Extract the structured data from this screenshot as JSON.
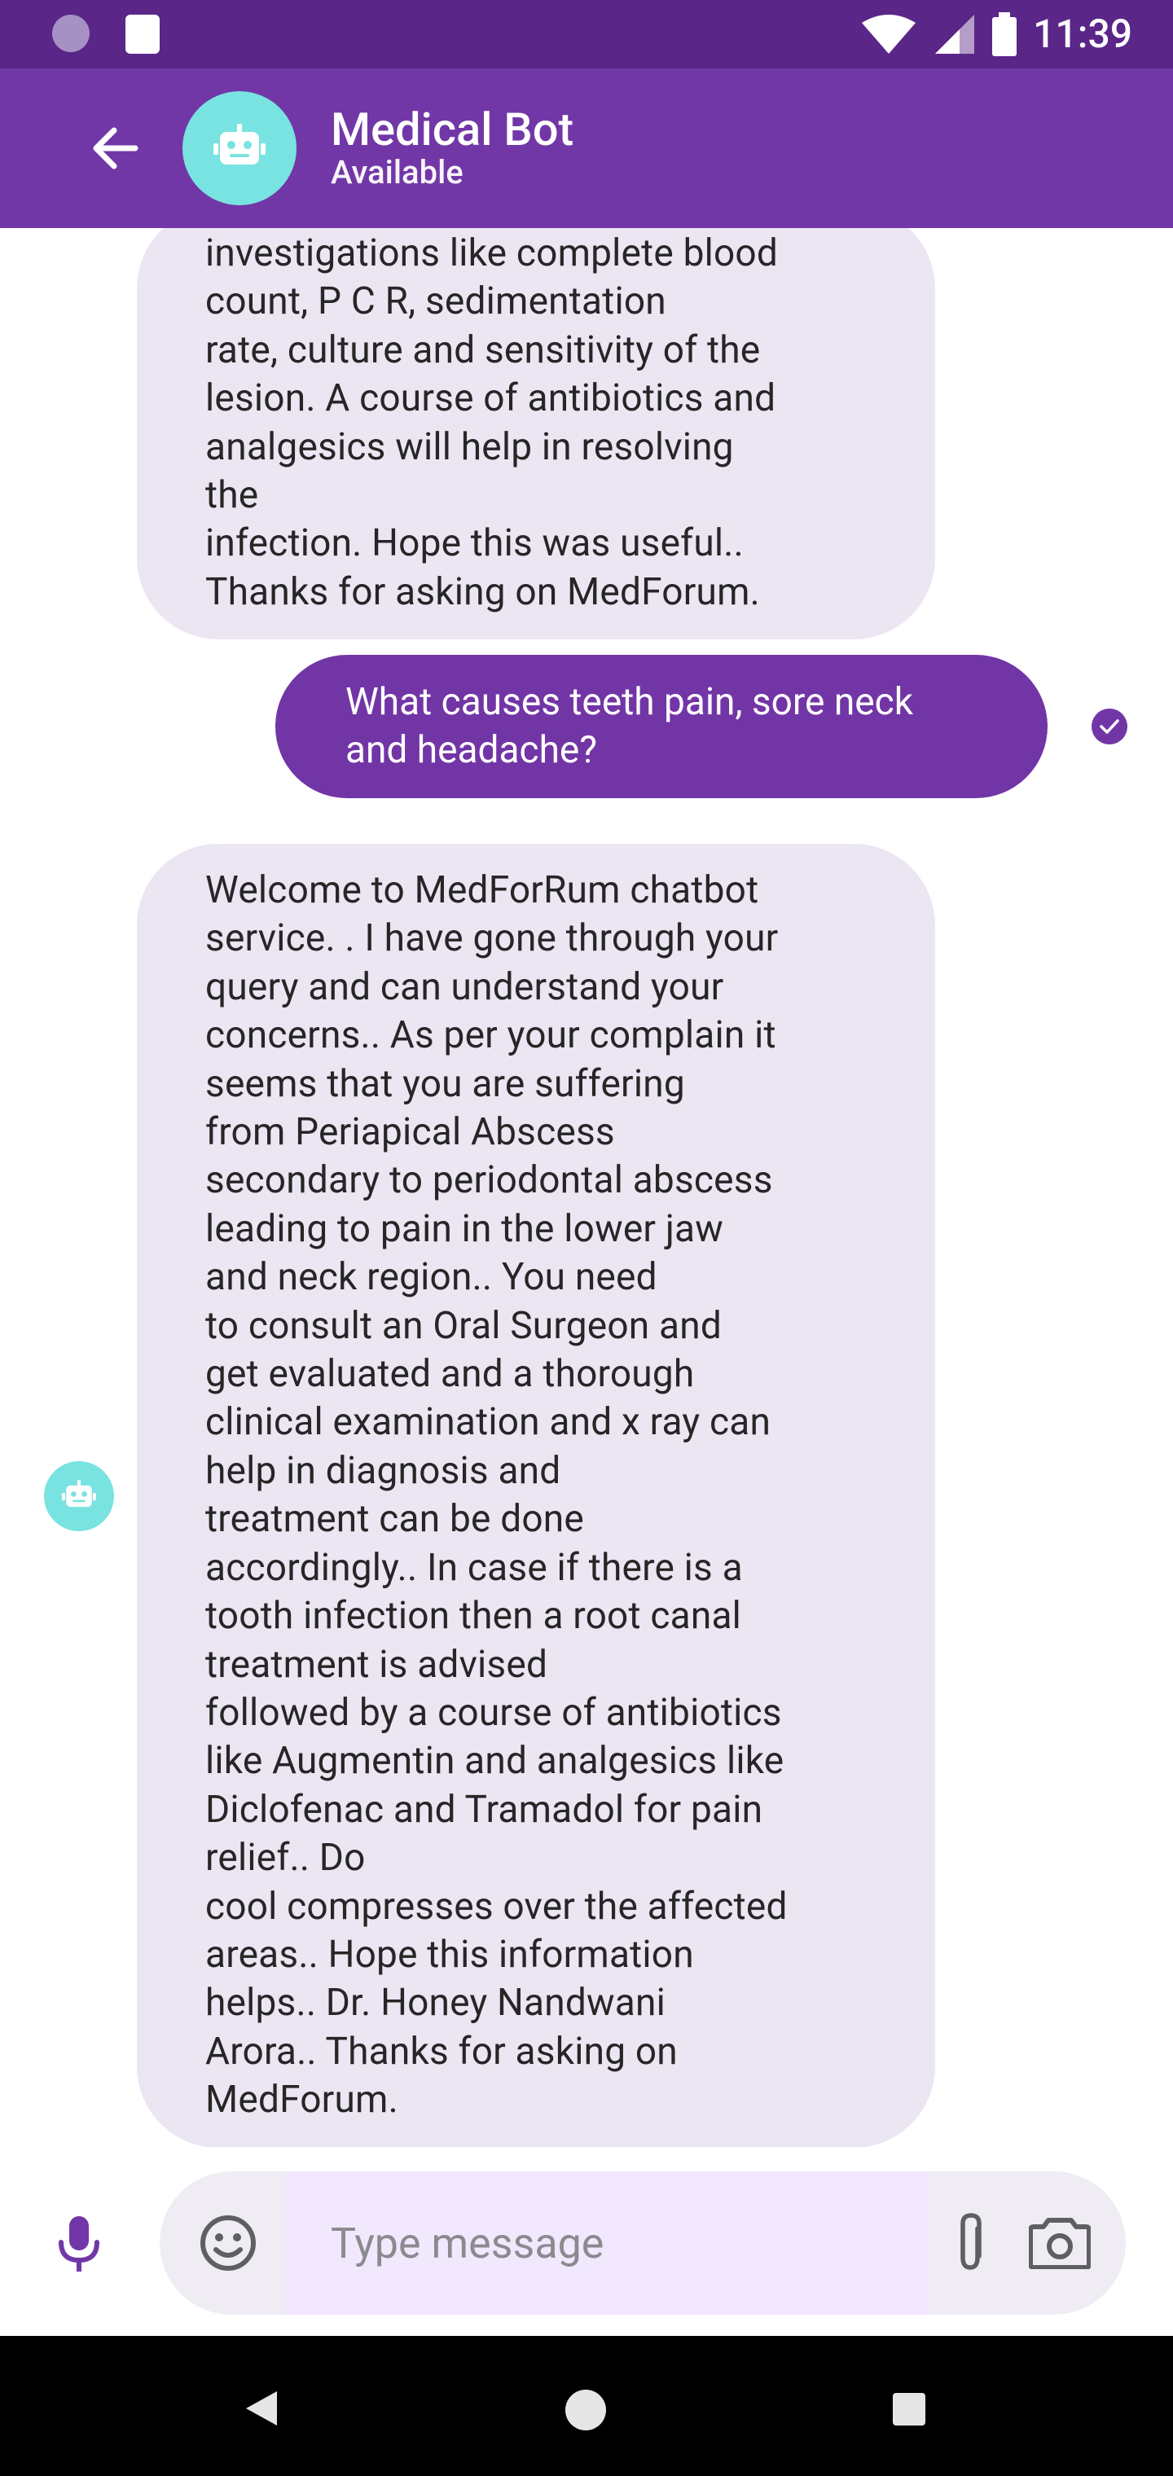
{
  "status_bar": {
    "time": "11:39"
  },
  "header": {
    "title": "Medical Bot",
    "subtitle": "Available",
    "avatar_color": "#79e3e1",
    "bg_color": "#7237a7"
  },
  "messages": [
    {
      "sender": "bot",
      "text": "investigations like complete blood\ncount,  P C R, sedimentation\nrate, culture and sensitivity of the\nlesion. A course of antibiotics and\nanalgesics will help in resolving\nthe\ninfection. Hope this was useful..\nThanks for asking on MedForum."
    },
    {
      "sender": "user",
      "text": "What causes teeth pain, sore neck\nand headache?"
    },
    {
      "sender": "bot",
      "text": "Welcome to MedForRum chatbot\nservice. . I have gone through your\nquery and can understand your\nconcerns.. As per your complain it\nseems that you are suffering\nfrom  Periapical  Abscess\nsecondary to periodontal abscess\nleading to pain in the lower jaw\nand neck region.. You need\nto consult an  Oral  Surgeon and\nget evaluated and a thorough\nclinical examination and x ray can\nhelp in diagnosis and\ntreatment can be done\naccordingly.. In case if there is a\ntooth infection then a root canal\ntreatment is advised\nfollowed by a course of antibiotics\nlike  Augmentin and analgesics like\nDiclofenac and  Tramadol for pain\nrelief.. Do\ncool compresses over the affected\nareas.. Hope this information\nhelps.. Dr. Honey  Nandwani\nArora.. Thanks for asking on\nMedForum."
    }
  ],
  "composer": {
    "placeholder": "Type message"
  },
  "colors": {
    "primary": "#7237a7",
    "bot_bubble": "#ece6f3",
    "user_bubble": "#7235a6",
    "accent": "#79e3e1"
  },
  "icons": [
    "sd-card-icon",
    "wifi-icon",
    "signal-icon",
    "battery-icon",
    "back-arrow-icon",
    "robot-icon",
    "check-icon",
    "mic-icon",
    "emoji-icon",
    "attach-icon",
    "camera-icon",
    "nav-back-icon",
    "nav-home-icon",
    "nav-recents-icon"
  ]
}
